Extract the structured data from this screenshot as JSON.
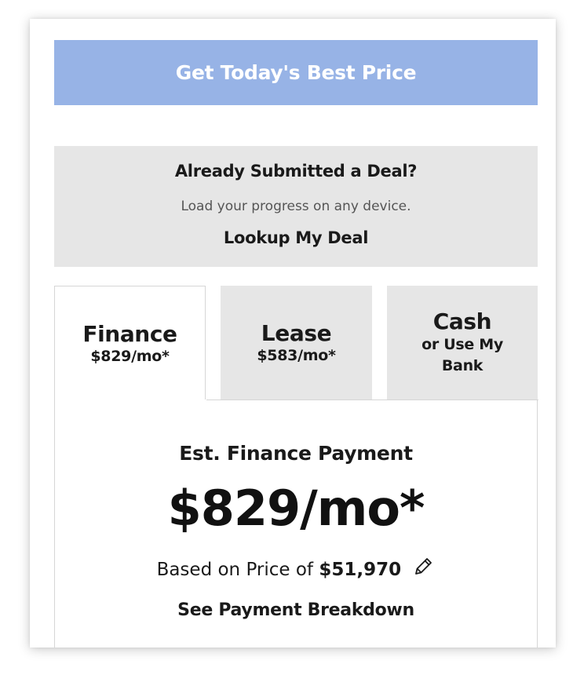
{
  "cta": {
    "label": "Get Today's Best Price",
    "color": "#97b3e6"
  },
  "lookup": {
    "title": "Already Submitted a Deal?",
    "subtitle": "Load your progress on any device.",
    "link_label": "Lookup My Deal"
  },
  "tabs": [
    {
      "title": "Finance",
      "subtitle": "$829/mo*",
      "selected": true
    },
    {
      "title": "Lease",
      "subtitle": "$583/mo*",
      "selected": false
    },
    {
      "title": "Cash",
      "subtitle": "or Use My Bank",
      "selected": false
    }
  ],
  "payment": {
    "label": "Est. Finance Payment",
    "amount": "$829/mo*",
    "price_prefix": "Based on Price of",
    "price_value": "$51,970",
    "edit_icon": "pencil-icon",
    "breakdown_label": "See Payment Breakdown"
  }
}
